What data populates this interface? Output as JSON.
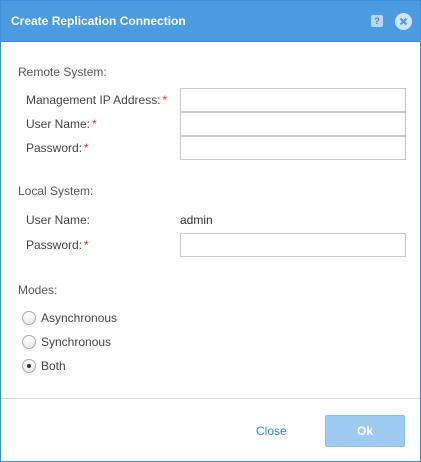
{
  "dialog": {
    "title": "Create Replication Connection",
    "help_icon": "question-mark",
    "close_icon": "x-circle"
  },
  "remote": {
    "section_label": "Remote System:",
    "mgmt_ip_label": "Management IP Address:",
    "mgmt_ip_value": "",
    "user_label": "User Name:",
    "user_value": "",
    "password_label": "Password:",
    "password_value": "",
    "required_mark": "*"
  },
  "local": {
    "section_label": "Local System:",
    "user_label": "User Name:",
    "user_value": "admin",
    "password_label": "Password:",
    "password_value": "",
    "required_mark": "*"
  },
  "modes": {
    "section_label": "Modes:",
    "options": [
      {
        "label": "Asynchronous",
        "selected": false
      },
      {
        "label": "Synchronous",
        "selected": false
      },
      {
        "label": "Both",
        "selected": true
      }
    ]
  },
  "footer": {
    "close_label": "Close",
    "ok_label": "Ok"
  },
  "colors": {
    "titlebar": "#4a9be0",
    "required": "#e0322f",
    "link": "#3a88d2",
    "ok_button": "#9ccaf0"
  }
}
